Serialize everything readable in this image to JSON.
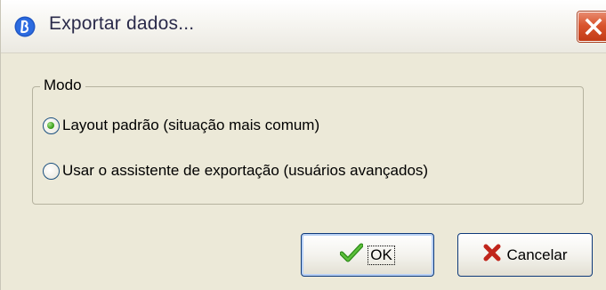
{
  "window": {
    "title": "Exportar dados...",
    "app_icon": "app-logo-icon",
    "close_icon": "close-icon"
  },
  "group": {
    "legend": "Modo",
    "options": [
      {
        "label": "Layout padrão (situação mais comum)",
        "checked": true
      },
      {
        "label": "Usar o assistente de exportação (usuários avançados)",
        "checked": false
      }
    ]
  },
  "buttons": {
    "ok": {
      "label": "OK",
      "icon": "checkmark-icon"
    },
    "cancel": {
      "label": "Cancelar",
      "icon": "x-icon"
    }
  },
  "colors": {
    "face": "#ece9d8",
    "close_red": "#d9542d",
    "check_green": "#3fa31d",
    "cancel_red": "#c0251b"
  }
}
